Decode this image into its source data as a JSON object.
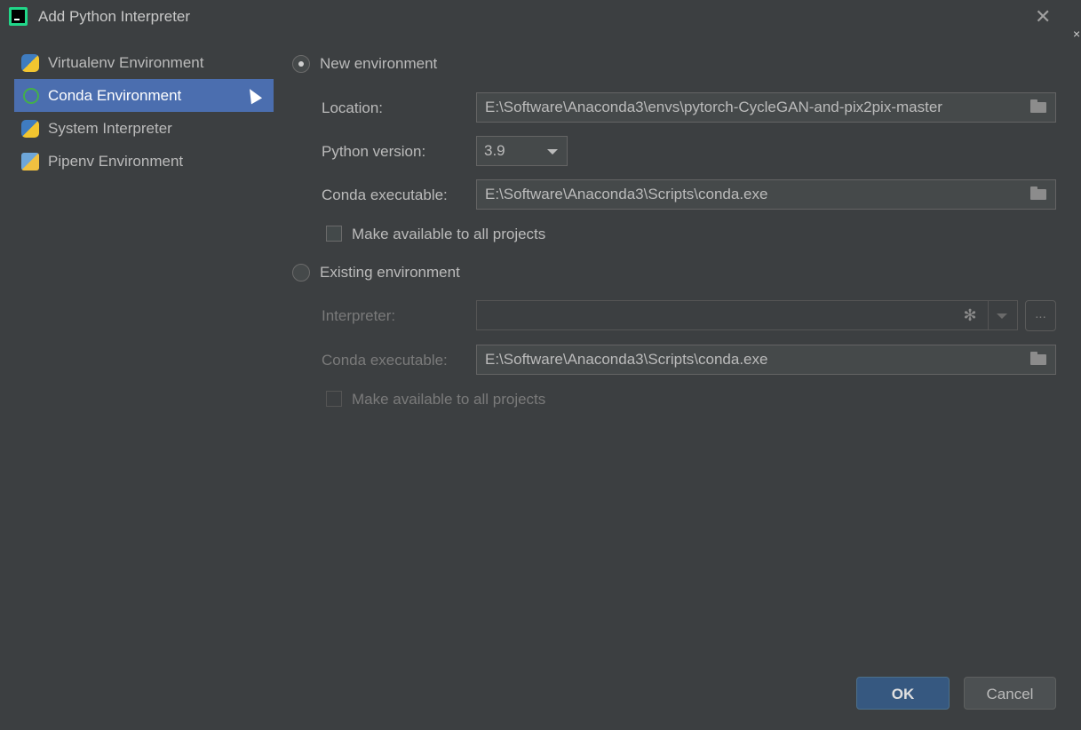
{
  "window": {
    "title": "Add Python Interpreter",
    "close_glyph": "✕",
    "edge_glyph": "×"
  },
  "sidebar": {
    "items": [
      {
        "label": "Virtualenv Environment",
        "icon": "python-icon",
        "selected": false
      },
      {
        "label": "Conda Environment",
        "icon": "conda-icon",
        "selected": true
      },
      {
        "label": "System Interpreter",
        "icon": "python-icon",
        "selected": false
      },
      {
        "label": "Pipenv Environment",
        "icon": "pipenv-icon",
        "selected": false
      }
    ]
  },
  "new_env": {
    "radio_label": "New environment",
    "checked": true,
    "location_label": "Location:",
    "location_value": "E:\\Software\\Anaconda3\\envs\\pytorch-CycleGAN-and-pix2pix-master",
    "python_version_label": "Python version:",
    "python_version_value": "3.9",
    "conda_exe_label": "Conda executable:",
    "conda_exe_value": "E:\\Software\\Anaconda3\\Scripts\\conda.exe",
    "make_available_label": "Make available to all projects",
    "make_available_checked": false
  },
  "existing_env": {
    "radio_label": "Existing environment",
    "checked": false,
    "interpreter_label": "Interpreter:",
    "interpreter_value": "",
    "browse_label": "...",
    "conda_exe_label": "Conda executable:",
    "conda_exe_value": "E:\\Software\\Anaconda3\\Scripts\\conda.exe",
    "make_available_label": "Make available to all projects",
    "make_available_checked": false
  },
  "buttons": {
    "ok": "OK",
    "cancel": "Cancel"
  },
  "colors": {
    "background": "#3c3f41",
    "selection": "#4b6eaf",
    "ok_button": "#365880"
  }
}
